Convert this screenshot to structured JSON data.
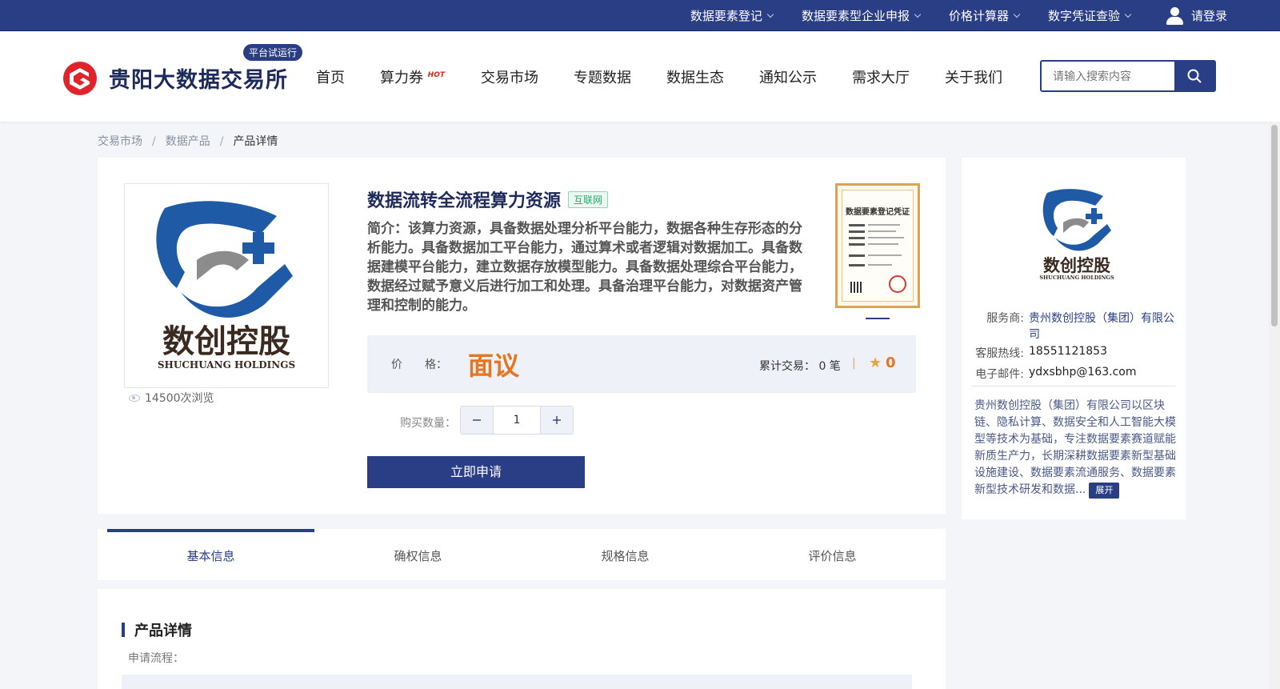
{
  "topbar": {
    "menu": [
      {
        "label": "数据要素登记"
      },
      {
        "label": "数据要素型企业申报"
      },
      {
        "label": "价格计算器"
      },
      {
        "label": "数字凭证查验"
      }
    ],
    "login_label": "请登录"
  },
  "header": {
    "brand": "贵阳大数据交易所",
    "beta_badge": "平台试运行",
    "nav": [
      {
        "label": "首页"
      },
      {
        "label": "算力券",
        "badge": "HOT"
      },
      {
        "label": "交易市场"
      },
      {
        "label": "专题数据"
      },
      {
        "label": "数据生态"
      },
      {
        "label": "通知公示"
      },
      {
        "label": "需求大厅"
      },
      {
        "label": "关于我们"
      }
    ],
    "search_placeholder": "请输入搜索内容"
  },
  "breadcrumb": {
    "items": [
      "交易市场",
      "数据产品"
    ],
    "current": "产品详情"
  },
  "product": {
    "title": "数据流转全流程算力资源",
    "tag": "互联网",
    "intro": "简介：该算力资源，具备数据处理分析平台能力，数据各种生存形态的分析能力。具备数据加工平台能力，通过算术或者逻辑对数据加工。具备数据建模平台能力，建立数据存放模型能力。具备数据处理综合平台能力，数据经过赋予意义后进行加工和处理。具备治理平台能力，对数据资产管理和控制的能力。",
    "views": "14500次浏览",
    "logo_cn": "数创控股",
    "logo_en": "SHUCHUANG HOLDINGS",
    "cert_title": "数据要素登记凭证",
    "price_label": "价　　格：",
    "price_value": "面议",
    "trade_label": "累计交易：",
    "trade_value": "0 笔",
    "trade_sep": "|",
    "score": "0",
    "quantity_label": "购买数量：",
    "quantity": "1",
    "apply_label": "立即申请"
  },
  "provider": {
    "service_label": "服务商:",
    "service_value": "贵州数创控股（集团）有限公司",
    "phone_label": "客服热线:",
    "phone_value": "18551121853",
    "email_label": "电子邮件:",
    "email_value": "ydxsbhp@163.com",
    "description": "贵州数创控股（集团）有限公司以区块链、隐私计算、数据安全和人工智能大模型等技术为基础，专注数据要素赛道赋能新质生产力，长期深耕数据要素新型基础设施建设、数据要素流通服务、数据要素新型技术研发和数据...",
    "expand_label": "展开"
  },
  "tabs": [
    {
      "label": "基本信息"
    },
    {
      "label": "确权信息"
    },
    {
      "label": "规格信息"
    },
    {
      "label": "评价信息"
    }
  ],
  "detail": {
    "title": "产品详情",
    "sub": "申请流程："
  },
  "colors": {
    "primary": "#2a3e85",
    "accent_orange": "#e5751f",
    "tag_green": "#2aa86a",
    "logo_red": "#e0242c"
  }
}
